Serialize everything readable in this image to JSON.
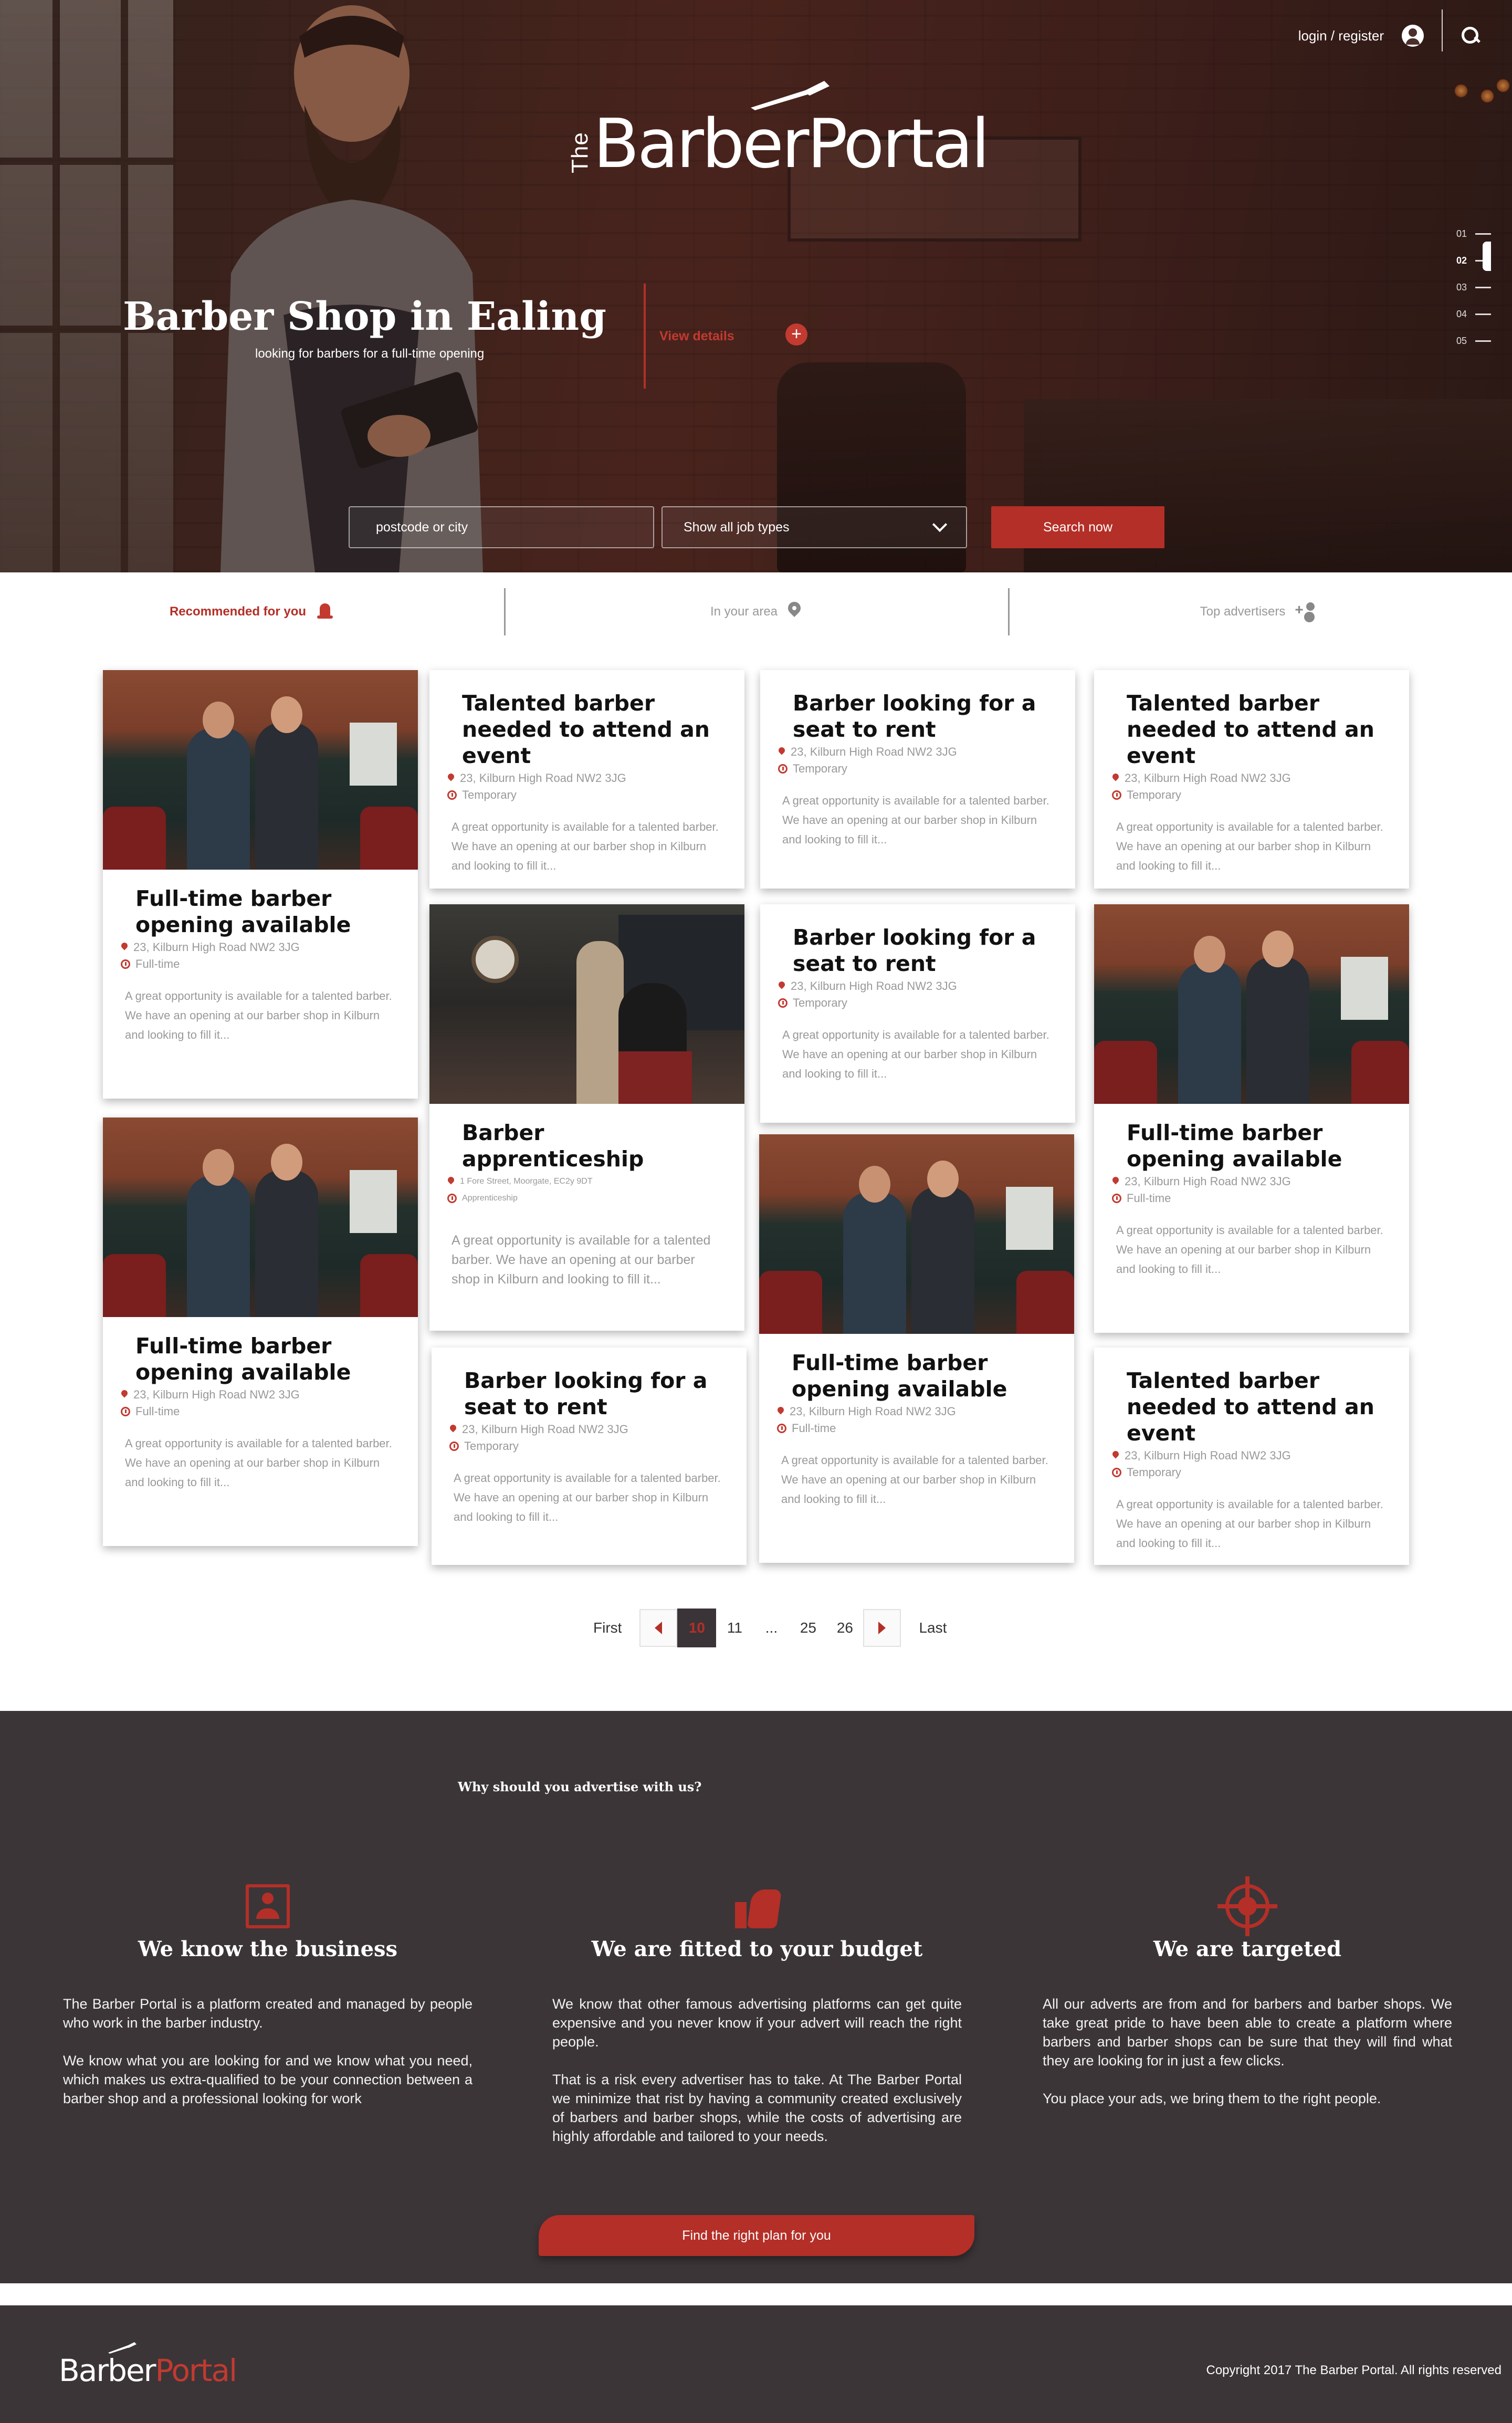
{
  "header": {
    "login_label": "login / register",
    "logo_the": "The",
    "logo_name": "BarberPortal"
  },
  "hero": {
    "title": "Barber Shop in Ealing",
    "subtitle": "looking for barbers for a full-time opening",
    "view_details": "View details",
    "plus": "+",
    "slides": [
      "01",
      "02",
      "03",
      "04",
      "05"
    ],
    "active_slide": "02"
  },
  "search": {
    "location_placeholder": "postcode or city",
    "job_type_selected": "Show all job types",
    "button_label": "Search now"
  },
  "tabs": [
    {
      "label": "Recommended for you",
      "icon": "bell-icon",
      "active": true
    },
    {
      "label": "In your area",
      "icon": "pin-icon",
      "active": false
    },
    {
      "label": "Top advertisers",
      "icon": "add-user-icon",
      "active": false
    }
  ],
  "listings": [
    {
      "title": "Full-time barber opening available",
      "address": "23, Kilburn High Road NW2 3JG",
      "type": "Full-time",
      "description": "A great opportunity is available for a talented barber. We have an opening at our barber shop in Kilburn and looking to fill it..."
    },
    {
      "title": "Talented barber needed to attend an event",
      "address": "23, Kilburn High Road NW2 3JG",
      "type": "Temporary",
      "description": "A great opportunity is available for a talented barber. We have an opening at our barber shop in Kilburn and looking to fill it..."
    },
    {
      "title": "Barber looking for a seat to rent",
      "address": "23, Kilburn High Road NW2 3JG",
      "type": "Temporary",
      "description": "A great opportunity is available for a talented barber. We have an opening at our barber shop in Kilburn and looking to fill it..."
    },
    {
      "title": "Talented barber needed to attend an event",
      "address": "23, Kilburn High Road NW2 3JG",
      "type": "Temporary",
      "description": "A great opportunity is available for a talented barber. We have an opening at our barber shop in Kilburn and looking to fill it..."
    },
    {
      "title": "Barber apprenticeship",
      "address": "1 Fore Street, Moorgate, EC2y 9DT",
      "type": "Apprenticeship",
      "description": "A great opportunity is available for a talented barber. We have an opening at our barber shop in Kilburn and looking to fill it..."
    },
    {
      "title": "Barber looking for a seat to rent",
      "address": "23, Kilburn High Road NW2 3JG",
      "type": "Temporary",
      "description": "A great opportunity is available for a talented barber. We have an opening at our barber shop in Kilburn and looking to fill it..."
    },
    {
      "title": "Full-time barber opening available",
      "address": "23, Kilburn High Road NW2 3JG",
      "type": "Full-time",
      "description": "A great opportunity is available for a talented barber. We have an opening at our barber shop in Kilburn and looking to fill it..."
    },
    {
      "title": "Full-time barber opening available",
      "address": "23, Kilburn High Road NW2 3JG",
      "type": "Full-time",
      "description": "A great opportunity is available for a talented barber. We have an opening at our barber shop in Kilburn and looking to fill it..."
    },
    {
      "title": "Barber looking for a seat to rent",
      "address": "23, Kilburn High Road NW2 3JG",
      "type": "Temporary",
      "description": "A great opportunity is available for a talented barber. We have an opening at our barber shop in Kilburn and looking to fill it..."
    },
    {
      "title": "Full-time barber opening available",
      "address": "23, Kilburn High Road NW2 3JG",
      "type": "Full-time",
      "description": "A great opportunity is available for a talented barber. We have an opening at our barber shop in Kilburn and looking to fill it..."
    },
    {
      "title": "Talented barber needed to attend an event",
      "address": "23, Kilburn High Road NW2 3JG",
      "type": "Temporary",
      "description": "A great opportunity is available for a talented barber. We have an opening at our barber shop in Kilburn and looking to fill it..."
    }
  ],
  "pagination": {
    "first": "First",
    "current": "10",
    "next_page": "11",
    "ellipsis": "...",
    "page_a": "25",
    "page_b": "26",
    "last": "Last"
  },
  "why": {
    "title": "Why should you advertise with us?",
    "columns": [
      {
        "heading": "We know the business",
        "icon": "user-square-icon",
        "p1": "The Barber Portal is a platform created and managed by people who work in the barber industry.",
        "p2": "We know what you are looking for and we know what you need, which makes us extra-qualified to be your connection between a barber shop and a professional looking for work"
      },
      {
        "heading": "We are fitted to your budget",
        "icon": "thumbs-up-icon",
        "p1": "We know that other famous advertising platforms can get quite expensive and you never know if your advert will reach the right people.",
        "p2": "That is a risk every advertiser has to take. At The Barber Portal we minimize that rist by having a community created exclusively of barbers and barber shops, while the costs of advertising are highly affordable and tailored to your needs."
      },
      {
        "heading": "We are targeted",
        "icon": "target-icon",
        "p1": "All our adverts are from and for barbers and barber shops. We take great pride to have been able to create a platform where barbers and barber shops can be sure that they will find what they are looking for in just a few clicks.",
        "p2": "You place your ads, we bring them to the right people."
      }
    ],
    "cta": "Find the right plan for you"
  },
  "footer": {
    "logo_barber": "Barber",
    "logo_portal": "Portal",
    "copyright": "Copyright 2017 The Barber Portal. All rights reserved"
  },
  "colors": {
    "accent": "#b42f27",
    "dark": "#3b3538"
  }
}
